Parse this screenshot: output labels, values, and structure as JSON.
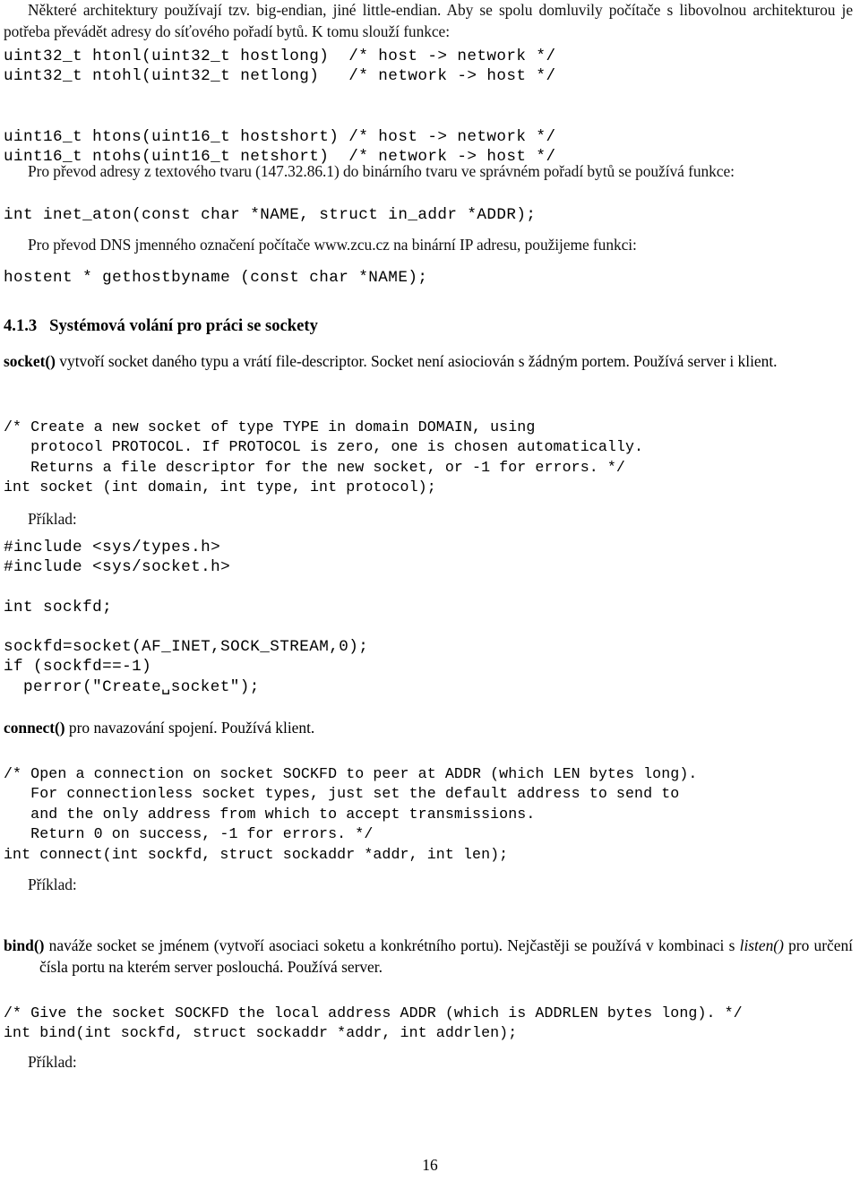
{
  "document": {
    "language": "cs",
    "page_number": "16",
    "section": {
      "number": "4.1.3",
      "title": "Systémová volání pro práci se sockety"
    }
  },
  "paragraphs": {
    "intro": "Některé architektury používají tzv. big-endian, jiné little-endian. Aby se spolu domluvily počítače s libovolnou architekturou je potřeba převádět adresy do síťového pořadí bytů. K tomu slouží funkce:",
    "inet_aton_intro": "Pro převod adresy z textového tvaru (147.32.86.1) do binárního tvaru ve správném pořadí bytů se používá funkce:",
    "gethostbyname_intro": "Pro převod DNS jmenného označení počítače www.zcu.cz na binární IP adresu, použijeme funkci:",
    "socket_desc_name": "socket()",
    "socket_desc_text": " vytvoří socket daného typu a vrátí file-descriptor. Socket není asiociován s žádným portem. Používá server i klient.",
    "connect_desc_name": "connect()",
    "connect_desc_text": " pro navazování spojení. Používá klient.",
    "bind_desc_name": "bind()",
    "bind_desc_text_a": " naváže socket se jménem (vytvoří asociaci soketu a konkrétního portu). Nejčastěji se používá v kombinaci s ",
    "bind_desc_listen": "listen()",
    "bind_desc_text_b": " pro určení čísla portu na kterém server poslouchá. Používá server.",
    "example_label_1": "Příklad:",
    "example_label_2": "Příklad:",
    "example_label_3": "Příklad:"
  },
  "code_blocks": {
    "byte_order": "uint32_t htonl(uint32_t hostlong)  /* host -> network */\nuint32_t ntohl(uint32_t netlong)   /* network -> host */\n\n\nuint16_t htons(uint16_t hostshort) /* host -> network */\nuint16_t ntohs(uint16_t netshort)  /* network -> host */",
    "inet_aton": "int inet_aton(const char *NAME, struct in_addr *ADDR);",
    "gethostbyname": "hostent * gethostbyname (const char *NAME);",
    "socket_decl": "/* Create a new socket of type TYPE in domain DOMAIN, using\n   protocol PROTOCOL. If PROTOCOL is zero, one is chosen automatically.\n   Returns a file descriptor for the new socket, or -1 for errors. */\nint socket (int domain, int type, int protocol);",
    "socket_example_includes": "#include <sys/types.h>\n#include <sys/socket.h>",
    "socket_example_decl": "int sockfd;",
    "socket_example_body_a": "sockfd=socket(AF_INET,SOCK_STREAM,0);\nif (sockfd==-1)\n  perror(\"Create",
    "socket_example_body_b": "socket\");",
    "connect_decl": "/* Open a connection on socket SOCKFD to peer at ADDR (which LEN bytes long).\n   For connectionless socket types, just set the default address to send to\n   and the only address from which to accept transmissions.\n   Return 0 on success, -1 for errors. */\nint connect(int sockfd, struct sockaddr *addr, int len);",
    "bind_decl": "/* Give the socket SOCKFD the local address ADDR (which is ADDRLEN bytes long). */\nint bind(int sockfd, struct sockaddr *addr, int addrlen);"
  }
}
